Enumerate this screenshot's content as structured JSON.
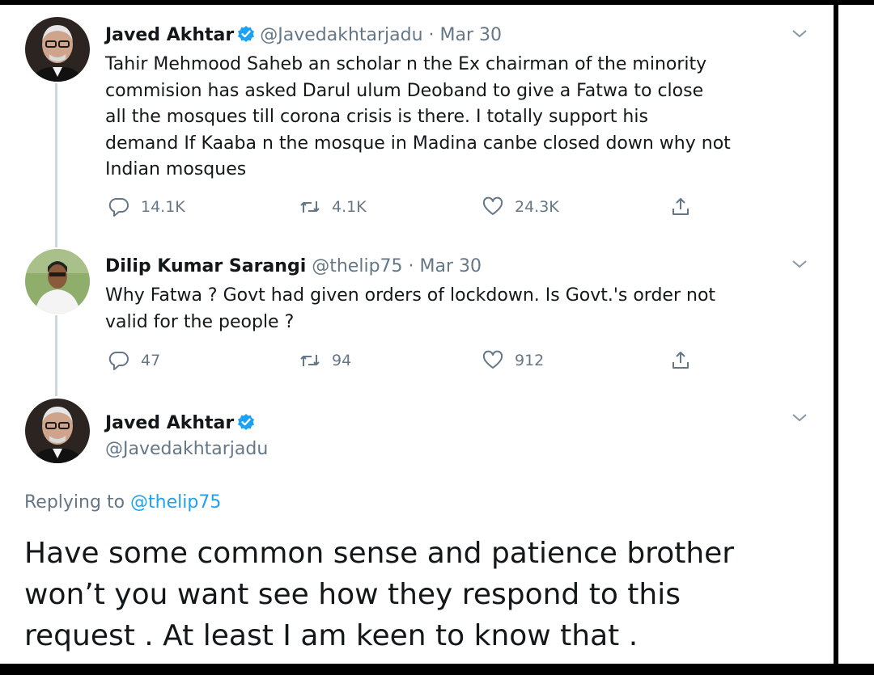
{
  "tweets": [
    {
      "name": "Javed Akhtar",
      "handle": "@Javedakhtarjadu",
      "date": "Mar 30",
      "lines": [
        "Tahir Mehmood Saheb an  scholar n the Ex chairman of the minority",
        "commision  has asked  Darul ulum Deoband to give a Fatwa to close",
        "all the mosques till corona crisis is there. I totally  support his",
        "demand If Kaaba n the mosque in Madina canbe closed down why not",
        "Indian mosques"
      ],
      "replies": "14.1K",
      "retweets": "4.1K",
      "likes": "24.3K"
    },
    {
      "name": "Dilip Kumar Sarangi",
      "handle": "@thelip75",
      "date": "Mar 30",
      "lines": [
        "Why Fatwa ? Govt had given orders of lockdown. Is Govt.'s order not",
        "valid for the people ?"
      ],
      "replies": "47",
      "retweets": "94",
      "likes": "912"
    }
  ],
  "main_tweet": {
    "name": "Javed Akhtar",
    "handle": "@Javedakhtarjadu",
    "replying_prefix": "Replying to",
    "replying_to": "@thelip75",
    "lines": [
      "Have some common sense and patience brother",
      "won’t you want see how they respond to this",
      "request . At least I am keen to know that ."
    ]
  },
  "separator": "·",
  "icons": {
    "reply": "reply-icon",
    "retweet": "retweet-icon",
    "like": "heart-icon",
    "share": "share-icon",
    "verified": "verified-badge-icon",
    "more": "chevron-down-icon"
  },
  "colors": {
    "name": "#14171a",
    "secondary": "#657786",
    "mention": "#1da1f2",
    "verified": "#1da1f2",
    "thread_line": "#ccd6dd"
  }
}
